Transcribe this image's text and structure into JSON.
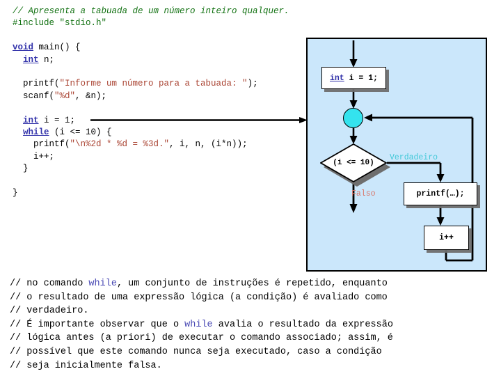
{
  "code": {
    "lines": [
      {
        "id": "l1",
        "segments": [
          {
            "text": "// Apresenta a tabuada de um número inteiro qualquer.",
            "style": "cmt"
          }
        ]
      },
      {
        "id": "l2",
        "segments": [
          {
            "text": "#include ",
            "style": "prep"
          },
          {
            "text": "\"stdio.h\"",
            "style": "prep"
          }
        ]
      },
      {
        "id": "l3",
        "segments": [
          {
            "text": "",
            "style": "plain"
          }
        ]
      },
      {
        "id": "l4",
        "segments": [
          {
            "text": "void",
            "style": "kw"
          },
          {
            "text": " main() {",
            "style": "plain"
          }
        ]
      },
      {
        "id": "l5",
        "segments": [
          {
            "text": "  ",
            "style": "plain"
          },
          {
            "text": "int",
            "style": "kw"
          },
          {
            "text": " n;",
            "style": "plain"
          }
        ]
      },
      {
        "id": "l6",
        "segments": [
          {
            "text": "",
            "style": "plain"
          }
        ]
      },
      {
        "id": "l7",
        "segments": [
          {
            "text": "  printf(",
            "style": "plain"
          },
          {
            "text": "\"Informe um número para a tabuada: \"",
            "style": "str"
          },
          {
            "text": ");",
            "style": "plain"
          }
        ]
      },
      {
        "id": "l8",
        "segments": [
          {
            "text": "  scanf(",
            "style": "plain"
          },
          {
            "text": "\"%d\"",
            "style": "str"
          },
          {
            "text": ", &n);",
            "style": "plain"
          }
        ]
      },
      {
        "id": "l9",
        "segments": [
          {
            "text": "",
            "style": "plain"
          }
        ]
      },
      {
        "id": "l10",
        "segments": [
          {
            "text": "  ",
            "style": "plain"
          },
          {
            "text": "int",
            "style": "kw"
          },
          {
            "text": " i = 1;",
            "style": "plain"
          }
        ]
      },
      {
        "id": "l11",
        "segments": [
          {
            "text": "  ",
            "style": "plain"
          },
          {
            "text": "while",
            "style": "kw"
          },
          {
            "text": " (i <= 10) {",
            "style": "plain"
          }
        ]
      },
      {
        "id": "l12",
        "segments": [
          {
            "text": "    printf(",
            "style": "plain"
          },
          {
            "text": "\"\\n%2d * %d = %3d.\"",
            "style": "str"
          },
          {
            "text": ", i, n, (i*n));",
            "style": "plain"
          }
        ]
      },
      {
        "id": "l13",
        "segments": [
          {
            "text": "    i++;",
            "style": "plain"
          }
        ]
      },
      {
        "id": "l14",
        "segments": [
          {
            "text": "  }",
            "style": "plain"
          }
        ]
      },
      {
        "id": "l15",
        "segments": [
          {
            "text": "",
            "style": "plain"
          }
        ]
      },
      {
        "id": "l16",
        "segments": [
          {
            "text": "}",
            "style": "plain"
          }
        ]
      }
    ]
  },
  "flowchart": {
    "panel_bg": "#cbe7fb",
    "nodes": {
      "init_keyword": "int",
      "init_rest": " i = 1;",
      "decision": "(i <= 10)",
      "print": "printf(…);",
      "increment": "i++"
    },
    "labels": {
      "true": "Verdadeiro",
      "false": "Falso"
    },
    "colors": {
      "true_label": "#41c8d8",
      "false_label": "#d9776a",
      "junction": "#34e3ee"
    }
  },
  "bottom_comments": {
    "lines": [
      {
        "id": "b1",
        "segments": [
          {
            "text": "// no comando ",
            "style": "plain"
          },
          {
            "text": "while",
            "style": "kw-plain"
          },
          {
            "text": ", um conjunto de instruções é repetido, enquanto",
            "style": "plain"
          }
        ]
      },
      {
        "id": "b2",
        "segments": [
          {
            "text": "// o resultado de uma expressão lógica (a condição) é avaliado como",
            "style": "plain"
          }
        ]
      },
      {
        "id": "b3",
        "segments": [
          {
            "text": "// verdadeiro.",
            "style": "plain"
          }
        ]
      },
      {
        "id": "b4",
        "segments": [
          {
            "text": "// É importante observar que o ",
            "style": "plain"
          },
          {
            "text": "while",
            "style": "kw-plain"
          },
          {
            "text": " avalia o resultado da expressão",
            "style": "plain"
          }
        ]
      },
      {
        "id": "b5",
        "segments": [
          {
            "text": "// lógica antes (a priori) de executar o comando associado; assim, é",
            "style": "plain"
          }
        ]
      },
      {
        "id": "b6",
        "segments": [
          {
            "text": "// possível que este comando nunca seja executado, caso a condição",
            "style": "plain"
          }
        ]
      },
      {
        "id": "b7",
        "segments": [
          {
            "text": "// seja inicialmente falsa.",
            "style": "plain"
          }
        ]
      }
    ]
  }
}
